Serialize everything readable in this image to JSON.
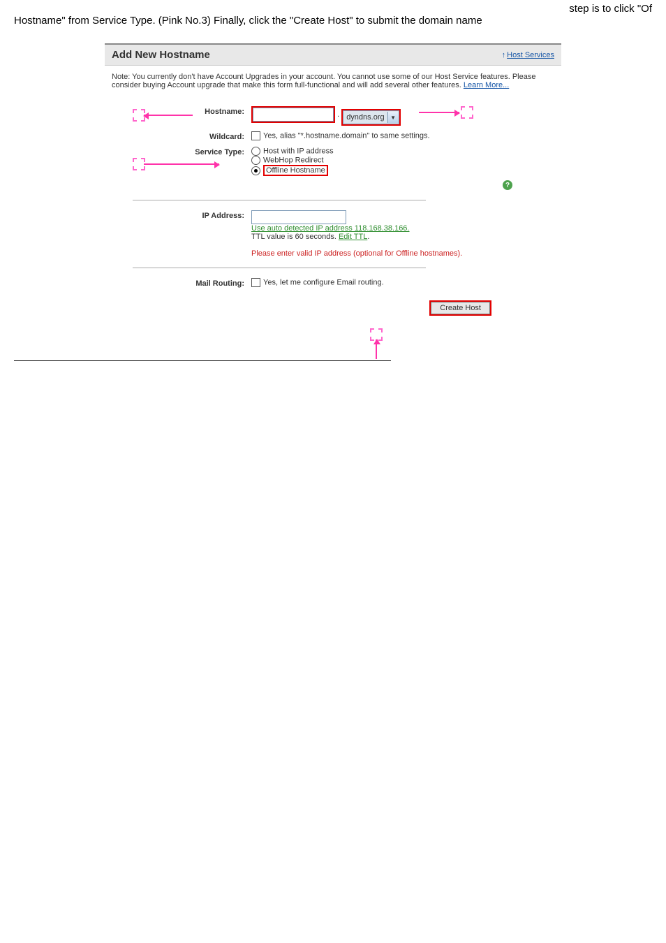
{
  "top": {
    "right_frag": "step is to click \"Of",
    "line2": "Hostname\" from Service Type. (Pink No.3) Finally, click the \"Create Host\" to submit the domain name"
  },
  "panel": {
    "title": "Add New Hostname",
    "host_services": "Host Services",
    "note": "Note: You currently don't have Account Upgrades in your account. You cannot use some of our Host Service features. Please consider buying Account upgrade that make this form full-functional and will add several other features. ",
    "learn_more": "Learn More..."
  },
  "form": {
    "hostname_label": "Hostname:",
    "hostname_value": "",
    "domain_selected": "dyndns.org",
    "wildcard_label": "Wildcard:",
    "wildcard_text": "Yes, alias \"*.hostname.domain\" to same settings.",
    "service_type_label": "Service Type:",
    "opt_ip": "Host with IP address",
    "opt_webhop": "WebHop Redirect",
    "opt_offline": "Offline Hostname",
    "ip_label": "IP Address:",
    "ip_value": "",
    "ip_auto": "Use auto detected IP address 118.168.38.166.",
    "ip_ttl": "TTL value is 60 seconds. ",
    "edit_ttl": "Edit TTL",
    "ip_warn": "Please enter valid IP address (optional for Offline hostnames).",
    "mail_label": "Mail Routing:",
    "mail_text": "Yes, let me configure Email routing.",
    "submit": "Create Host"
  },
  "icons": {
    "help": "?",
    "up": "↑",
    "dot": "."
  }
}
